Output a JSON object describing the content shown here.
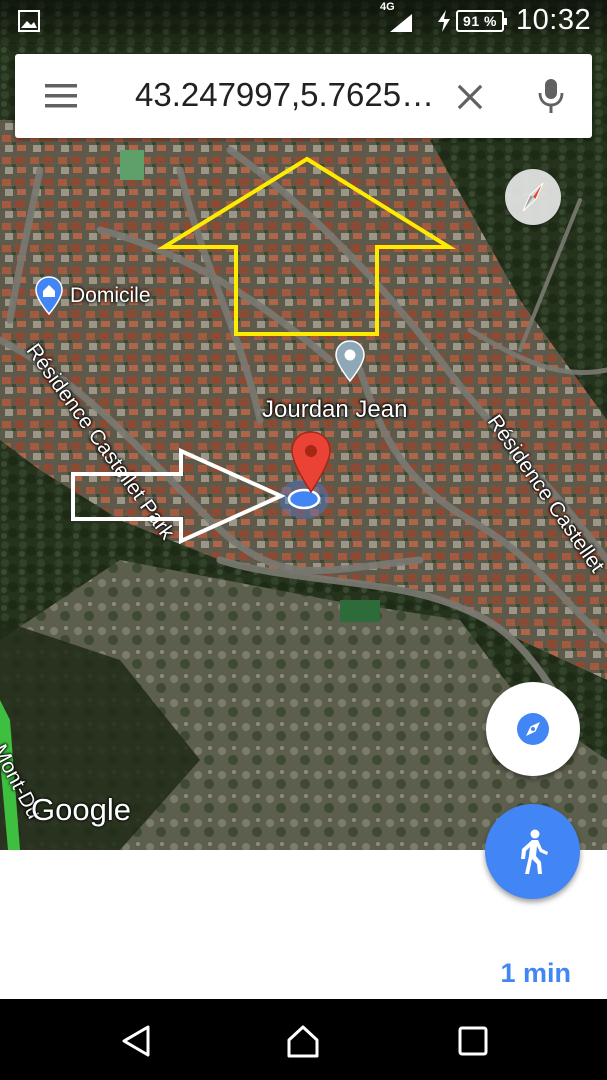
{
  "status_bar": {
    "network": "4G",
    "battery": "91 %",
    "time": "10:32"
  },
  "search": {
    "query": "43.247997,5.7625…"
  },
  "map": {
    "street_left": "Résidence Castellet Park",
    "street_right": "Résidence Castellet",
    "street_bottom": "Mont-Du",
    "place_home": "Domicile",
    "place_poi": "Jourdan Jean",
    "attribution": "Google",
    "annotation_colors": {
      "up_arrow": "#ffeb00",
      "right_arrow": "#ffffff"
    }
  },
  "bottom_sheet": {
    "eta": "1 min"
  },
  "colors": {
    "accent": "#4285f4",
    "pin_red": "#ea4335"
  },
  "icons": {
    "menu": "hamburger-menu-icon",
    "clear": "close-icon",
    "mic": "microphone-icon",
    "compass": "compass-icon",
    "locate": "navigation-compass-icon",
    "walk": "walking-person-icon",
    "nav_back": "back-triangle-icon",
    "nav_home": "home-icon",
    "nav_recents": "recents-square-icon"
  }
}
